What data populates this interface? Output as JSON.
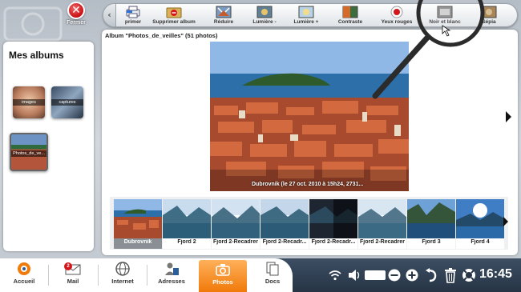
{
  "window": {
    "close_label": "Fermer"
  },
  "toolbar": {
    "items": [
      {
        "label": "primer",
        "icon": "printer-icon"
      },
      {
        "label": "Supprimer album",
        "icon": "delete-album-icon"
      },
      {
        "label": "Réduire",
        "icon": "reduce-icon"
      },
      {
        "label": "Lumière -",
        "icon": "light-minus-icon"
      },
      {
        "label": "Lumière +",
        "icon": "light-plus-icon"
      },
      {
        "label": "Contraste",
        "icon": "contrast-icon"
      },
      {
        "label": "Yeux rouges",
        "icon": "red-eye-icon"
      },
      {
        "label": "Noir et blanc",
        "icon": "black-white-icon"
      },
      {
        "label": "Sépia",
        "icon": "sepia-icon"
      }
    ]
  },
  "sidebar": {
    "title": "Mes albums",
    "albums": [
      {
        "label": "images"
      },
      {
        "label": "captures"
      },
      {
        "label": "Photos_de_ve..."
      }
    ]
  },
  "main": {
    "header": "Album \"Photos_de_veilles\" (51 photos)",
    "caption": "Dubrovnik (le 27 oct. 2010 à 15h24, 2731..."
  },
  "filmstrip": {
    "items": [
      {
        "label": "Dubrovnik",
        "selected": true
      },
      {
        "label": "Fjord 2",
        "selected": false
      },
      {
        "label": "Fjord 2-Recadrer",
        "selected": false
      },
      {
        "label": "Fjord 2-Recadr...",
        "selected": false
      },
      {
        "label": "Fjord 2-Recadr...",
        "selected": false
      },
      {
        "label": "Fjord 2-Recadrer",
        "selected": false
      },
      {
        "label": "Fjord 3",
        "selected": false
      },
      {
        "label": "Fjord 4",
        "selected": false
      }
    ]
  },
  "taskbar": {
    "items": [
      {
        "label": "Accueil",
        "icon": "home-icon"
      },
      {
        "label": "Mail",
        "icon": "mail-icon",
        "badge": "2"
      },
      {
        "label": "Internet",
        "icon": "globe-icon"
      },
      {
        "label": "Adresses",
        "icon": "contacts-icon"
      },
      {
        "label": "Photos",
        "icon": "camera-icon",
        "active": true
      },
      {
        "label": "Docs",
        "icon": "documents-icon"
      }
    ],
    "clock": "16:45"
  },
  "colors": {
    "accent_orange": "#f07a0a",
    "close_red": "#c80e12",
    "taskbar_dark": "#263445"
  }
}
